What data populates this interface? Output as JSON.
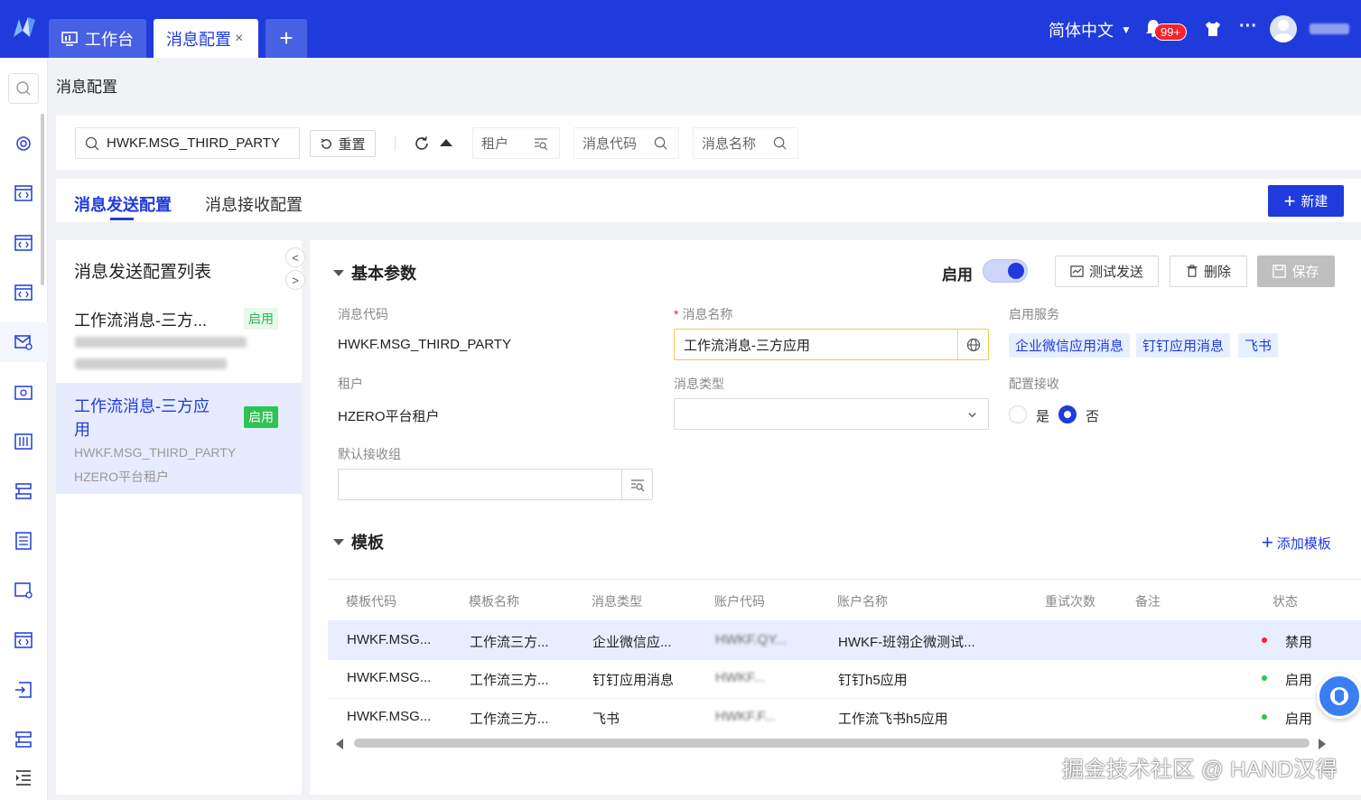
{
  "topbar": {
    "tabs": [
      {
        "label": "工作台"
      },
      {
        "label": "消息配置",
        "close": "×"
      },
      {
        "label": "+"
      }
    ],
    "language": "简体中文",
    "notification_badge": "99+",
    "more": "···",
    "accent": "#1f3bdc"
  },
  "breadcrumb": "消息配置",
  "filter": {
    "search_value": "HWKF.MSG_THIRD_PARTY",
    "reset_label": "重置",
    "chips": [
      "租户",
      "消息代码",
      "消息名称"
    ]
  },
  "tabs": [
    {
      "label": "消息发送配置"
    },
    {
      "label": "消息接收配置"
    }
  ],
  "new_button": "新建",
  "list": {
    "title": "消息发送配置列表",
    "items": [
      {
        "title": "工作流消息-三方...",
        "status": "启用"
      },
      {
        "title": "工作流消息-三方应用",
        "status": "启用",
        "code": "HWKF.MSG_THIRD_PARTY",
        "tenant": "HZERO平台租户"
      }
    ]
  },
  "detail": {
    "section_basic": "基本参数",
    "enable_label": "启用",
    "enabled": true,
    "test_button": "测试发送",
    "delete_button": "删除",
    "save_button": "保存",
    "fields": {
      "code_label": "消息代码",
      "code_value": "HWKF.MSG_THIRD_PARTY",
      "name_label": "消息名称",
      "name_value": "工作流消息-三方应用",
      "service_label": "启用服务",
      "services": [
        "企业微信应用消息",
        "钉钉应用消息",
        "飞书"
      ],
      "tenant_label": "租户",
      "tenant_value": "HZERO平台租户",
      "type_label": "消息类型",
      "receive_label": "配置接收",
      "radio_yes": "是",
      "radio_no": "否",
      "group_label": "默认接收组"
    },
    "section_template": "模板",
    "add_template": "添加模板"
  },
  "table": {
    "headers": [
      "模板代码",
      "模板名称",
      "消息类型",
      "账户代码",
      "账户名称",
      "重试次数",
      "备注",
      "状态"
    ],
    "rows": [
      {
        "code": "HWKF.MSG...",
        "name": "工作流三方...",
        "type": "企业微信应...",
        "account": "HWKF.QY...",
        "account_name": "HWKF-班翎企微测试...",
        "status": "禁用",
        "status_color": "#f5222d"
      },
      {
        "code": "HWKF.MSG...",
        "name": "工作流三方...",
        "type": "钉钉应用消息",
        "account": "HWKF...",
        "account_name": "钉钉h5应用",
        "status": "启用",
        "status_color": "#2fc354"
      },
      {
        "code": "HWKF.MSG...",
        "name": "工作流三方...",
        "type": "飞书",
        "account": "HWKF.F...",
        "account_name": "工作流飞书h5应用",
        "status": "启用",
        "status_color": "#2fc354"
      }
    ]
  },
  "watermark": "掘金技术社区 @ HAND汉得"
}
